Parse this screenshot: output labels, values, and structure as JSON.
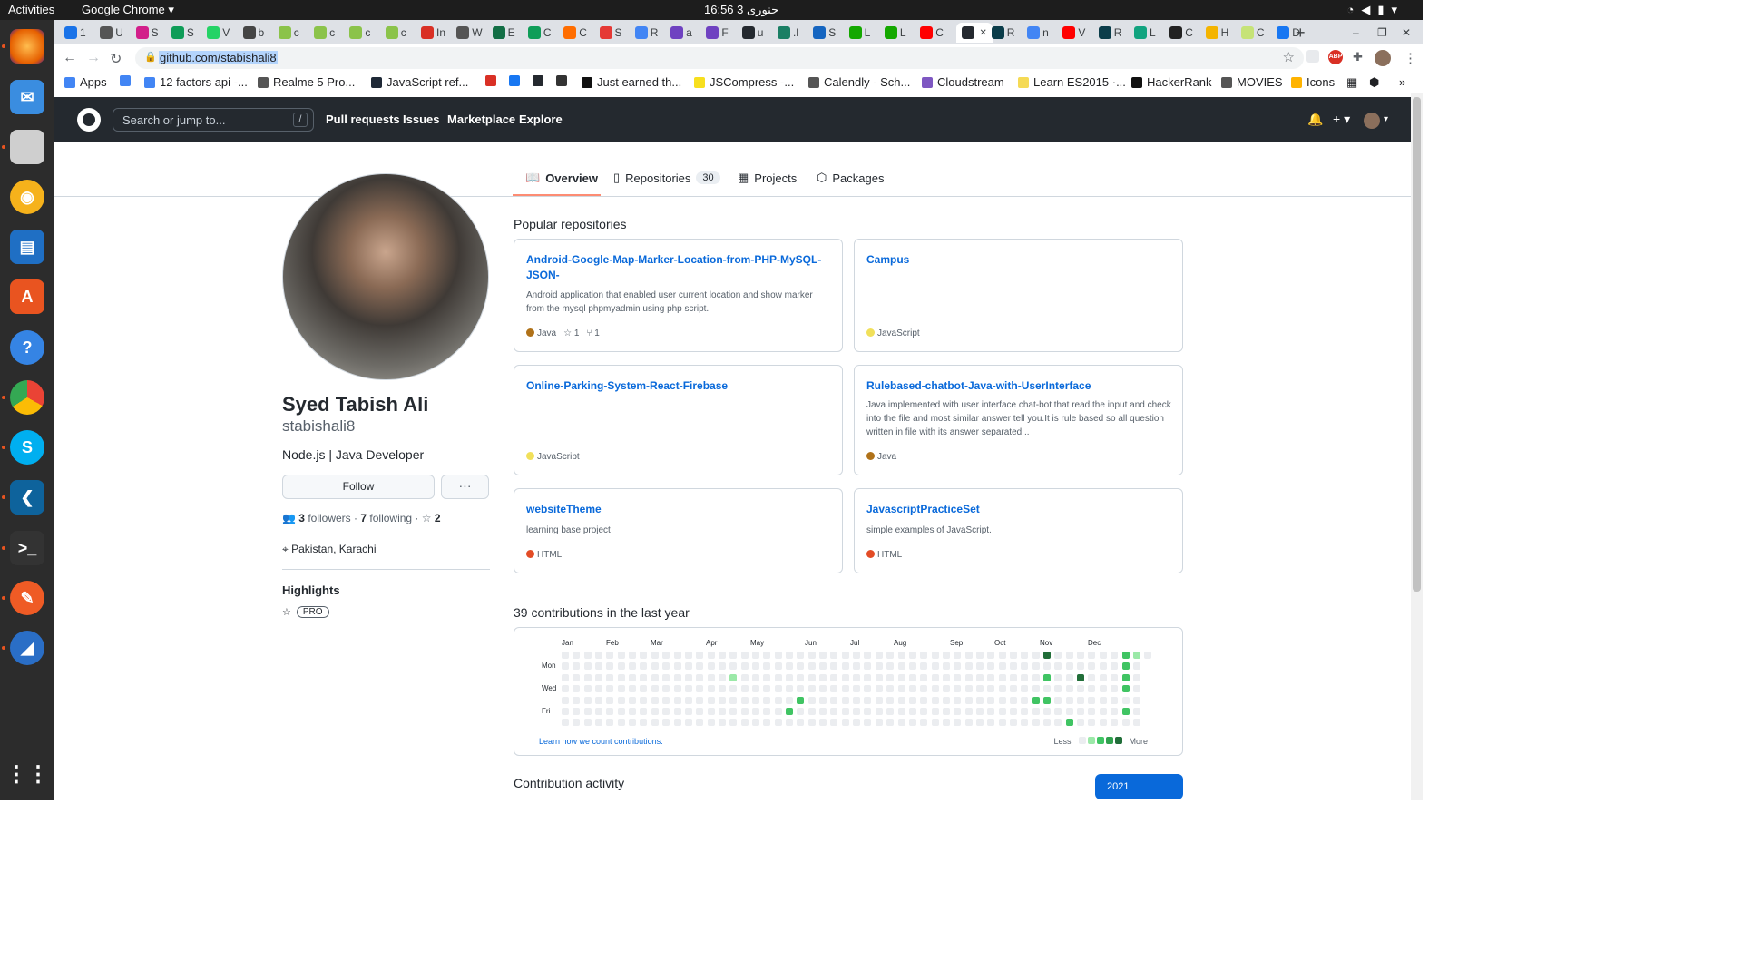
{
  "system": {
    "activities": "Activities",
    "app_name": "Google Chrome ▾",
    "clock": "16:56 جنوری 3"
  },
  "tabs": [
    {
      "label": "1",
      "fav_color": "#1a73e8"
    },
    {
      "label": "U",
      "fav_color": "#555555"
    },
    {
      "label": "S",
      "fav_color": "#d21f8a"
    },
    {
      "label": "S",
      "fav_color": "#0f9d58"
    },
    {
      "label": "V",
      "fav_color": "#25d366"
    },
    {
      "label": "b",
      "fav_color": "#444444"
    },
    {
      "label": "c",
      "fav_color": "#8bc34a"
    },
    {
      "label": "c",
      "fav_color": "#8bc34a"
    },
    {
      "label": "c",
      "fav_color": "#8bc34a"
    },
    {
      "label": "c",
      "fav_color": "#8bc34a"
    },
    {
      "label": "In",
      "fav_color": "#d93025"
    },
    {
      "label": "W",
      "fav_color": "#555555"
    },
    {
      "label": "E",
      "fav_color": "#126e45"
    },
    {
      "label": "C",
      "fav_color": "#0f9d58"
    },
    {
      "label": "C",
      "fav_color": "#ff6d00"
    },
    {
      "label": "S",
      "fav_color": "#e53935"
    },
    {
      "label": "R",
      "fav_color": "#4285f4"
    },
    {
      "label": "a",
      "fav_color": "#6f42c1"
    },
    {
      "label": "F",
      "fav_color": "#6f42c1"
    },
    {
      "label": "u",
      "fav_color": "#24292f"
    },
    {
      "label": ".l",
      "fav_color": "#1a7f64"
    },
    {
      "label": "S",
      "fav_color": "#1565c0"
    },
    {
      "label": "L",
      "fav_color": "#14a800"
    },
    {
      "label": "L",
      "fav_color": "#14a800"
    },
    {
      "label": "C",
      "fav_color": "#ff0000"
    },
    {
      "label": "",
      "fav_color": "#24292f"
    },
    {
      "label": "R",
      "fav_color": "#0b3d4a"
    },
    {
      "label": "n",
      "fav_color": "#4285f4"
    },
    {
      "label": "V",
      "fav_color": "#ff0000"
    },
    {
      "label": "R",
      "fav_color": "#0b3d4a"
    },
    {
      "label": "L",
      "fav_color": "#11a37f"
    },
    {
      "label": "C",
      "fav_color": "#222222"
    },
    {
      "label": "H",
      "fav_color": "#f4b400"
    },
    {
      "label": "C",
      "fav_color": "#c6e377"
    },
    {
      "label": "D",
      "fav_color": "#1877f2"
    }
  ],
  "address_bar": {
    "url": "github.com/stabishali8"
  },
  "bookmarks": [
    {
      "label": "Apps",
      "icon": "apps-grid-icon",
      "color": "#4285f4"
    },
    {
      "label": "",
      "icon": "google-icon",
      "color": "#4285f4"
    },
    {
      "label": "12 factors api -...",
      "icon": "google-icon",
      "color": "#4285f4"
    },
    {
      "label": "Realme 5 Pro...",
      "icon": "globe-icon",
      "color": "#555555"
    },
    {
      "label": "JavaScript ref...",
      "icon": "mdn-icon",
      "color": "#1f2937"
    },
    {
      "label": "",
      "icon": "gmail-icon",
      "color": "#d93025"
    },
    {
      "label": "",
      "icon": "facebook-icon",
      "color": "#1877f2"
    },
    {
      "label": "",
      "icon": "github-icon",
      "color": "#24292f"
    },
    {
      "label": "",
      "icon": "pen-icon",
      "color": "#333333"
    },
    {
      "label": "Just earned th...",
      "icon": "hackerrank-icon",
      "color": "#111111"
    },
    {
      "label": "JSCompress -...",
      "icon": "js-icon",
      "color": "#f7df1e"
    },
    {
      "label": "Calendly - Sch...",
      "icon": "globe-icon",
      "color": "#555555"
    },
    {
      "label": "Cloudstream",
      "icon": "cloudstream-icon",
      "color": "#7e57c2"
    },
    {
      "label": "Learn ES2015 ·...",
      "icon": "babel-icon",
      "color": "#f5da55"
    },
    {
      "label": "HackerRank",
      "icon": "hackerrank-icon",
      "color": "#111111"
    },
    {
      "label": "MOVIES",
      "icon": "globe-icon",
      "color": "#555555"
    },
    {
      "label": "Icons",
      "icon": "icons-icon",
      "color": "#ffb300"
    }
  ],
  "github_header": {
    "search_placeholder": "Search or jump to...",
    "search_key": "/",
    "nav": [
      "Pull requests",
      "Issues",
      "Marketplace",
      "Explore"
    ]
  },
  "profile_tabs": [
    {
      "label": "Overview",
      "icon": "book-icon"
    },
    {
      "label": "Repositories",
      "icon": "repo-icon",
      "count": "30"
    },
    {
      "label": "Projects",
      "icon": "project-icon"
    },
    {
      "label": "Packages",
      "icon": "package-icon"
    }
  ],
  "profile": {
    "name": "Syed Tabish Ali",
    "login": "stabishali8",
    "bio": "Node.js | Java Developer",
    "follow_label": "Follow",
    "more_label": "···",
    "followers_count": "3",
    "followers_label": "followers",
    "following_count": "7",
    "following_label": "following",
    "stars_count": "2",
    "location": "Pakistan, Karachi",
    "highlights_title": "Highlights",
    "highlight_badge": "PRO"
  },
  "popular_title": "Popular repositories",
  "repos": [
    {
      "name": "Android-Google-Map-Marker-Location-from-PHP-MySQL-JSON-",
      "description": "Android application that enabled user current location and show marker from the mysql phpmyadmin using php script.",
      "language": "Java",
      "language_color": "#b07219",
      "stars": "1",
      "forks": "1"
    },
    {
      "name": "Campus",
      "description": "",
      "language": "JavaScript",
      "language_color": "#f1e05a"
    },
    {
      "name": "Online-Parking-System-React-Firebase",
      "description": "",
      "language": "JavaScript",
      "language_color": "#f1e05a"
    },
    {
      "name": "Rulebased-chatbot-Java-with-UserInterface",
      "description": "Java implemented with user interface chat-bot that read the input and check into the file and most similar answer tell you.It is rule based so all question written in file with its answer separated...",
      "language": "Java",
      "language_color": "#b07219"
    },
    {
      "name": "websiteTheme",
      "description": "learning base project",
      "language": "HTML",
      "language_color": "#e34c26"
    },
    {
      "name": "JavascriptPracticeSet",
      "description": "simple examples of JavaScript.",
      "language": "HTML",
      "language_color": "#e34c26"
    }
  ],
  "contributions": {
    "title": "39 contributions in the last year",
    "months": [
      "Jan",
      "Feb",
      "Mar",
      "Apr",
      "May",
      "Jun",
      "Jul",
      "Aug",
      "Sep",
      "Oct",
      "Nov",
      "Dec"
    ],
    "day_labels": [
      "Mon",
      "Wed",
      "Fri"
    ],
    "learn_link": "Learn how we count contributions.",
    "legend_less": "Less",
    "legend_more": "More",
    "level_colors": [
      "#ebedf0",
      "#9be9a8",
      "#40c463",
      "#30a14e",
      "#216e39"
    ],
    "weeks": 53,
    "active_cells": [
      {
        "week": 15,
        "day": 2,
        "level": 1
      },
      {
        "week": 20,
        "day": 5,
        "level": 2
      },
      {
        "week": 21,
        "day": 4,
        "level": 2
      },
      {
        "week": 43,
        "day": 2,
        "level": 2
      },
      {
        "week": 42,
        "day": 4,
        "level": 2
      },
      {
        "week": 43,
        "day": 4,
        "level": 2
      },
      {
        "week": 43,
        "day": 0,
        "level": 4
      },
      {
        "week": 46,
        "day": 2,
        "level": 4
      },
      {
        "week": 45,
        "day": 6,
        "level": 2
      },
      {
        "week": 50,
        "day": 0,
        "level": 2
      },
      {
        "week": 50,
        "day": 1,
        "level": 2
      },
      {
        "week": 50,
        "day": 2,
        "level": 2
      },
      {
        "week": 50,
        "day": 3,
        "level": 2
      },
      {
        "week": 50,
        "day": 5,
        "level": 2
      },
      {
        "week": 51,
        "day": 0,
        "level": 1
      }
    ]
  },
  "activity": {
    "title": "Contribution activity",
    "year": "2021"
  }
}
